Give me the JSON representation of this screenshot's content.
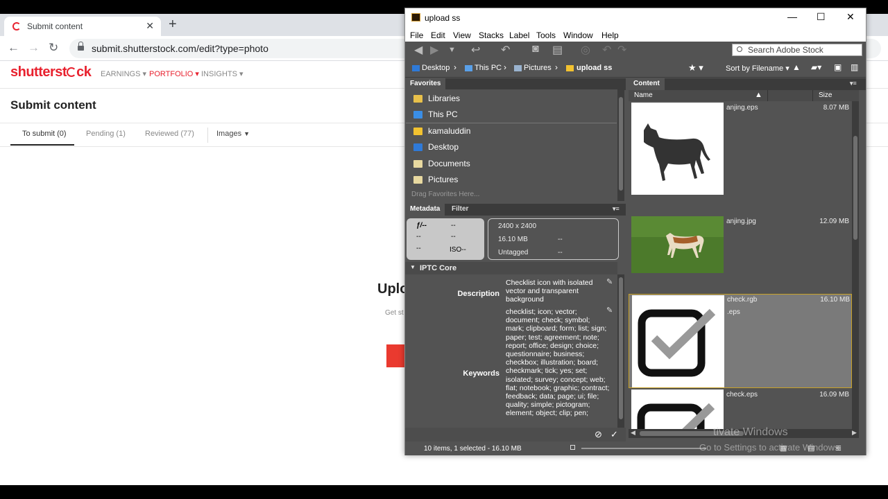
{
  "browser": {
    "tab_title": "Submit content",
    "url": "submit.shutterstock.com/edit?type=photo"
  },
  "ss": {
    "logo_left": "shutterst",
    "logo_right": "ck",
    "nav": [
      "EARNINGS",
      "PORTFOLIO",
      "INSIGHTS"
    ],
    "page_title": "Submit content",
    "tabs": [
      "To submit (0)",
      "Pending (1)",
      "Reviewed (77)"
    ],
    "type_select": "Images",
    "upload_heading": "Uplo",
    "upload_sub": "Get st"
  },
  "bridge": {
    "title": "upload ss",
    "menu": [
      "File",
      "Edit",
      "View",
      "Stacks",
      "Label",
      "Tools",
      "Window",
      "Help"
    ],
    "search_placeholder": "Search Adobe Stock",
    "path": [
      "Desktop",
      "This PC",
      "Pictures",
      "upload ss"
    ],
    "sort_label": "Sort by Filename",
    "favorites_tab": "Favorites",
    "favorites": [
      {
        "label": "Libraries",
        "color": "#e8c04a"
      },
      {
        "label": "This PC",
        "color": "#3a8ee6"
      },
      {
        "label": "kamaluddin",
        "color": "#f2c230"
      },
      {
        "label": "Desktop",
        "color": "#2f7ad8"
      },
      {
        "label": "Documents",
        "color": "#e8d9a0"
      },
      {
        "label": "Pictures",
        "color": "#e8d9a0"
      }
    ],
    "drag_hint": "Drag Favorites Here...",
    "metadata_tab": "Metadata",
    "filter_tab": "Filter",
    "camera": {
      "fstop": "ƒ/--",
      "v1": "--",
      "v2": "--",
      "v3": "--",
      "v4": "--",
      "iso": "ISO--"
    },
    "file_info": {
      "dims": "2400 x 2400",
      "size": "16.10 MB",
      "label": "Untagged",
      "d1": "--",
      "d2": "--"
    },
    "iptc_header": "IPTC Core",
    "description_label": "Description",
    "description": "Checklist icon with isolated vector and transparent background",
    "keywords_label": "Keywords",
    "keywords": "checklist; icon; vector; document; check; symbol; mark; clipboard; form; list; sign; paper; test; agreement; note; report; office; design; choice; questionnaire; business; checkbox; illustration; board; checkmark; tick; yes; set; isolated; survey; concept; web; flat; notebook; graphic; contract; feedback; data; page; ui; file; quality; simple; pictogram; element; object; clip; pen;",
    "content_tab": "Content",
    "col_name": "Name",
    "col_size": "Size",
    "items": [
      {
        "name": "anjing.eps",
        "size": "8.07 MB"
      },
      {
        "name": "anjing.jpg",
        "size": "12.09 MB"
      },
      {
        "name": "check.rgb",
        "name2": ".eps",
        "size": "16.10 MB"
      },
      {
        "name": "check.eps",
        "size": "16.09 MB"
      }
    ],
    "status": "10 items, 1 selected - 16.10 MB"
  },
  "watermark": {
    "line1": "tivate Windows",
    "line2": "Go to Settings to activate Windows."
  },
  "colors": {
    "brand": "#e8212e",
    "bridge_bg": "#535353",
    "selection": "#c9a227"
  }
}
